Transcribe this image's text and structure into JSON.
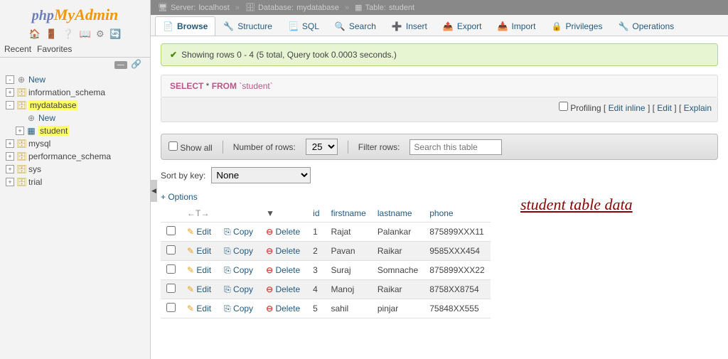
{
  "logo": {
    "php": "php",
    "my": "My",
    "admin": "Admin"
  },
  "sidebar_tabs": {
    "recent": "Recent",
    "favorites": "Favorites"
  },
  "tree": [
    {
      "level": 0,
      "exp": "-",
      "icon": "",
      "label": "New",
      "hl": false,
      "link": true
    },
    {
      "level": 0,
      "exp": "+",
      "icon": "db",
      "label": "information_schema",
      "hl": false
    },
    {
      "level": 0,
      "exp": "-",
      "icon": "db",
      "label": "mydatabase",
      "hl": true
    },
    {
      "level": 1,
      "exp": "",
      "icon": "",
      "label": "New",
      "hl": false,
      "link": true
    },
    {
      "level": 1,
      "exp": "+",
      "icon": "tbl",
      "label": "student",
      "hl": true
    },
    {
      "level": 0,
      "exp": "+",
      "icon": "db",
      "label": "mysql",
      "hl": false
    },
    {
      "level": 0,
      "exp": "+",
      "icon": "db",
      "label": "performance_schema",
      "hl": false
    },
    {
      "level": 0,
      "exp": "+",
      "icon": "db",
      "label": "sys",
      "hl": false
    },
    {
      "level": 0,
      "exp": "+",
      "icon": "db",
      "label": "trial",
      "hl": false
    }
  ],
  "breadcrumb": {
    "server_label": "Server:",
    "server": "localhost",
    "db_label": "Database:",
    "db": "mydatabase",
    "table_label": "Table:",
    "table": "student"
  },
  "tabs": [
    {
      "icon": "📄",
      "label": "Browse",
      "active": true
    },
    {
      "icon": "🔧",
      "label": "Structure"
    },
    {
      "icon": "📃",
      "label": "SQL"
    },
    {
      "icon": "🔍",
      "label": "Search"
    },
    {
      "icon": "➕",
      "label": "Insert"
    },
    {
      "icon": "📤",
      "label": "Export"
    },
    {
      "icon": "📥",
      "label": "Import"
    },
    {
      "icon": "🔒",
      "label": "Privileges"
    },
    {
      "icon": "🔧",
      "label": "Operations"
    }
  ],
  "success_msg": "Showing rows 0 - 4 (5 total, Query took 0.0003 seconds.)",
  "sql": {
    "select": "SELECT",
    "star": " * ",
    "from": "FROM",
    "tbl": " `student`"
  },
  "query_actions": {
    "profiling": "Profiling",
    "edit_inline": "Edit inline",
    "edit": "Edit",
    "explain": "Explain"
  },
  "filter": {
    "show_all": "Show all",
    "num_rows_label": "Number of rows:",
    "num_rows_value": "25",
    "filter_label": "Filter rows:",
    "filter_placeholder": "Search this table"
  },
  "sortkey": {
    "label": "Sort by key:",
    "value": "None"
  },
  "options_link": "+ Options",
  "columns": [
    "id",
    "firstname",
    "lastname",
    "phone"
  ],
  "nav_arrow_sym": "←T→",
  "row_labels": {
    "edit": "Edit",
    "copy": "Copy",
    "delete": "Delete"
  },
  "rows": [
    {
      "id": "1",
      "firstname": "Rajat",
      "lastname": "Palankar",
      "phone": "875899XXX11"
    },
    {
      "id": "2",
      "firstname": "Pavan",
      "lastname": "Raikar",
      "phone": "9585XXX454"
    },
    {
      "id": "3",
      "firstname": "Suraj",
      "lastname": "Somnache",
      "phone": "875899XXX22"
    },
    {
      "id": "4",
      "firstname": "Manoj",
      "lastname": "Raikar",
      "phone": "8758XX8754"
    },
    {
      "id": "5",
      "firstname": "sahil",
      "lastname": "pinjar",
      "phone": "75848XX555"
    }
  ],
  "annotation": "student table data"
}
